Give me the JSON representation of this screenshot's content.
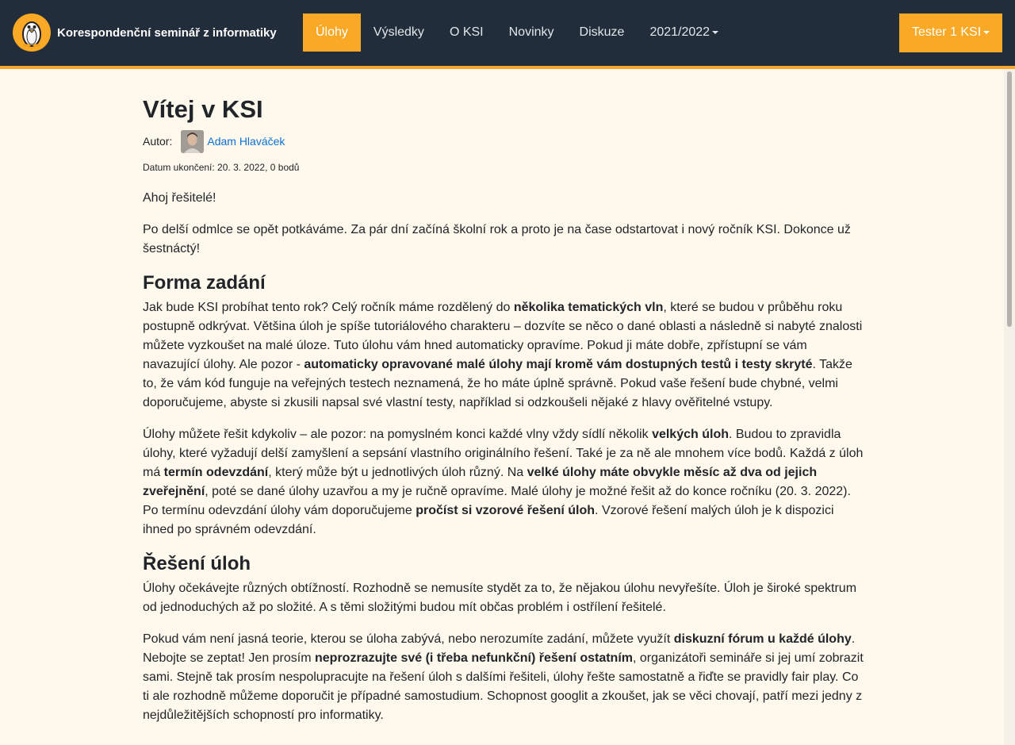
{
  "navbar": {
    "brand": "Korespondenční seminář z informatiky",
    "logo_icon": "penguin-logo-icon",
    "items": [
      {
        "label": "Úlohy",
        "active": true
      },
      {
        "label": "Výsledky",
        "active": false
      },
      {
        "label": "O KSI",
        "active": false
      },
      {
        "label": "Novinky",
        "active": false
      },
      {
        "label": "Diskuze",
        "active": false
      },
      {
        "label": "2021/2022",
        "active": false,
        "dropdown": true
      }
    ],
    "user": "Tester 1 KSI"
  },
  "colors": {
    "navbar_bg": "#222d3b",
    "accent": "#f9a926",
    "page_bg": "#fff8ec",
    "link": "#0b72d6"
  },
  "article": {
    "title": "Vítej v KSI",
    "author_label": "Autor:",
    "author_name": "Adam Hlaváček",
    "deadline": "Datum ukončení: 20. 3. 2022, 0 bodů",
    "p1": "Ahoj řešitelé!",
    "p2": "Po delší odmlce se opět potkáváme. Za pár dní začíná školní rok a proto je na čase odstartovat i nový ročník KSI. Dokonce už šestnáctý!",
    "h_forma": "Forma zadání",
    "p3": [
      "Jak bude KSI probíhat tento rok? Celý ročník máme rozdělený do ",
      "několika tematických vln",
      ", které se budou v průběhu roku postupně odkrývat. Většina úloh je spíše tutoriálového charakteru – dozvíte se něco o dané oblasti a následně si nabyté znalosti můžete vyzkoušet na malé úloze. Tuto úlohu vám hned automaticky opravíme. Pokud ji máte dobře, zpřístupní se vám navazující úlohy. Ale pozor - ",
      "automaticky opravované malé úlohy mají kromě vám dostupných testů i testy skryté",
      ". Takže to, že vám kód funguje na veřejných testech neznamená, že ho máte úplně správně. Pokud vaše řešení bude chybné, velmi doporučujeme, abyste si zkusili napsal své vlastní testy, například si odzkoušeli nějaké z hlavy ověřitelné vstupy."
    ],
    "p4": [
      "Úlohy můžete řešit kdykoliv – ale pozor: na pomyslném konci každé vlny vždy sídlí několik ",
      "velkých úloh",
      ". Budou to zpravidla úlohy, které vyžadují delší zamyšlení a sepsání vlastního originálního řešení. Také je za ně ale mnohem více bodů. Každá z úloh má ",
      "termín odevzdání",
      ", který může být u jednotlivých úloh různý. Na ",
      "velké úlohy máte obvykle měsíc až dva od jejich zveřejnění",
      ", poté se dané úlohy uzavřou a my je ručně opravíme. Malé úlohy je možné řešit až do konce ročníku (20. 3. 2022). Po termínu odevzdání úlohy vám doporučujeme ",
      "pročíst si vzorové řešení úloh",
      ". Vzorové řešení malých úloh je k dispozici ihned po správném odevzdání."
    ],
    "h_reseni": "Řešení úloh",
    "p5": "Úlohy očekávejte různých obtížností. Rozhodně se nemusíte stydět za to, že nějakou úlohu nevyřešíte. Úloh je široké spektrum od jednoduchých až po složité. A s těmi složitými budou mít občas problém i ostřílení řešitelé.",
    "p6": [
      "Pokud vám není jasná teorie, kterou se úloha zabývá, nebo nerozumíte zadání, můžete využít ",
      "diskuzní fórum u každé úlohy",
      ". Nebojte se zeptat! Jen prosím ",
      "neprozrazujte své (i třeba nefunkční) řešení ostatním",
      ", organizátoři semináře si jej umí zobrazit sami. Stejně tak prosím nespolupracujte na řešení úloh s dalšími řešiteli, úlohy řešte samostatně a řiďte se pravidly fair play. Co ti ale rozhodně můžeme doporučit je případné samostudium. Schopnost googlit a zkoušet, jak se věci chovají, patří mezi jedny z nejdůležitějších schopností pro informatiky."
    ]
  }
}
